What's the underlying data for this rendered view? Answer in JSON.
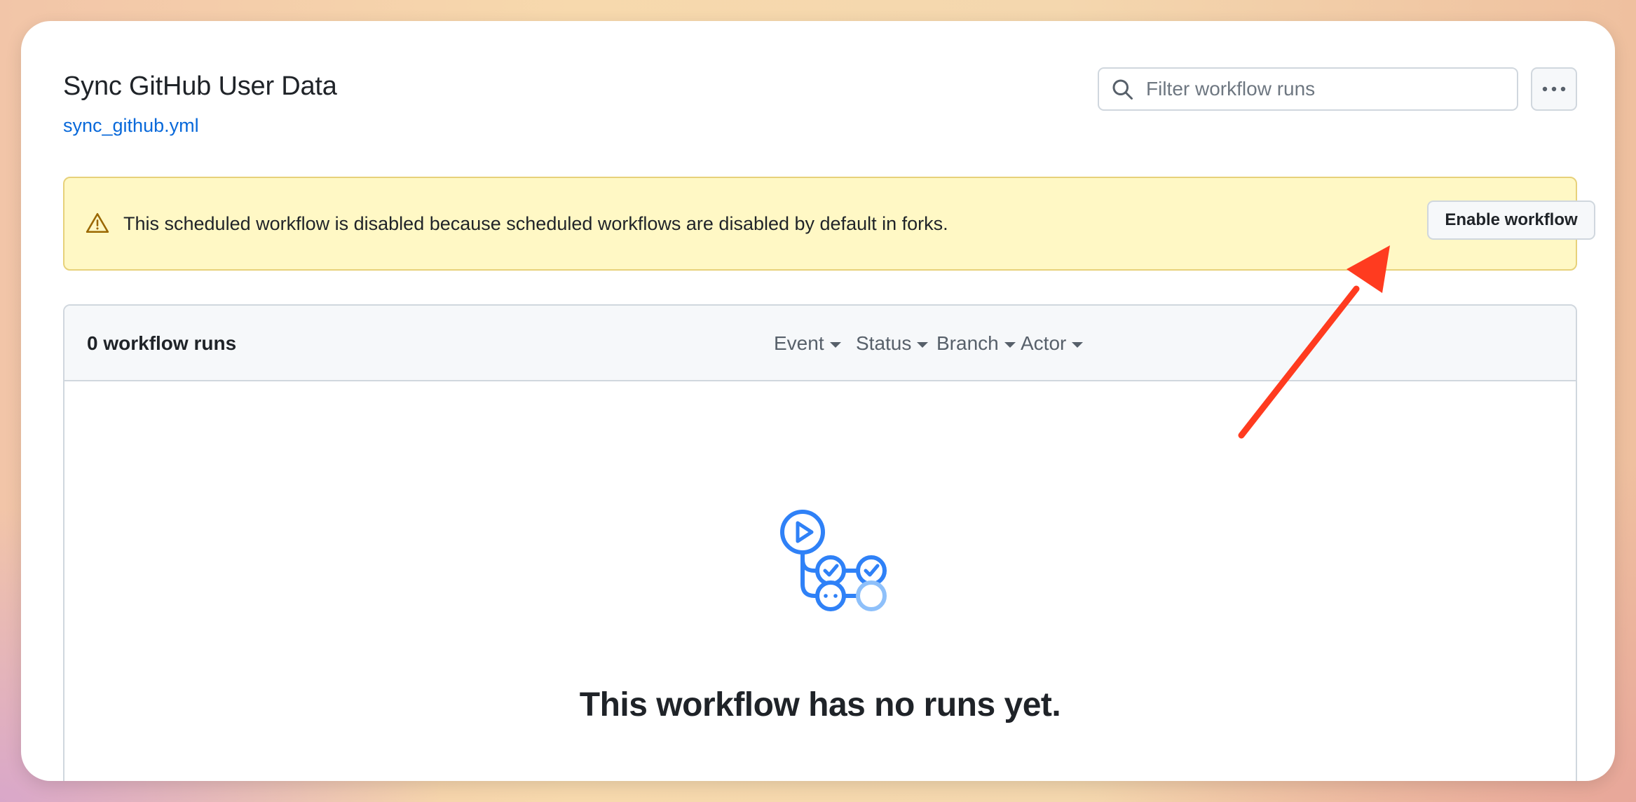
{
  "workflow": {
    "title": "Sync GitHub User Data",
    "file": "sync_github.yml"
  },
  "search": {
    "placeholder": "Filter workflow runs",
    "value": ""
  },
  "banner": {
    "message": "This scheduled workflow is disabled because scheduled workflows are disabled by default in forks.",
    "button_label": "Enable workflow"
  },
  "runs": {
    "count_label": "0 workflow runs",
    "filters": [
      "Event",
      "Status",
      "Branch",
      "Actor"
    ],
    "empty_title": "This workflow has no runs yet."
  },
  "icons": {
    "search": "search-icon",
    "more": "kebab-horizontal-icon",
    "warning": "alert-triangle-icon",
    "empty_state": "workflow-graph-icon",
    "annotation": "red-arrow-pointer"
  },
  "colors": {
    "link": "#0969da",
    "banner_bg": "#fff8c5",
    "warning": "#9a6700",
    "icon_blue": "#2f81f7",
    "annotation": "#ff3b1f"
  }
}
